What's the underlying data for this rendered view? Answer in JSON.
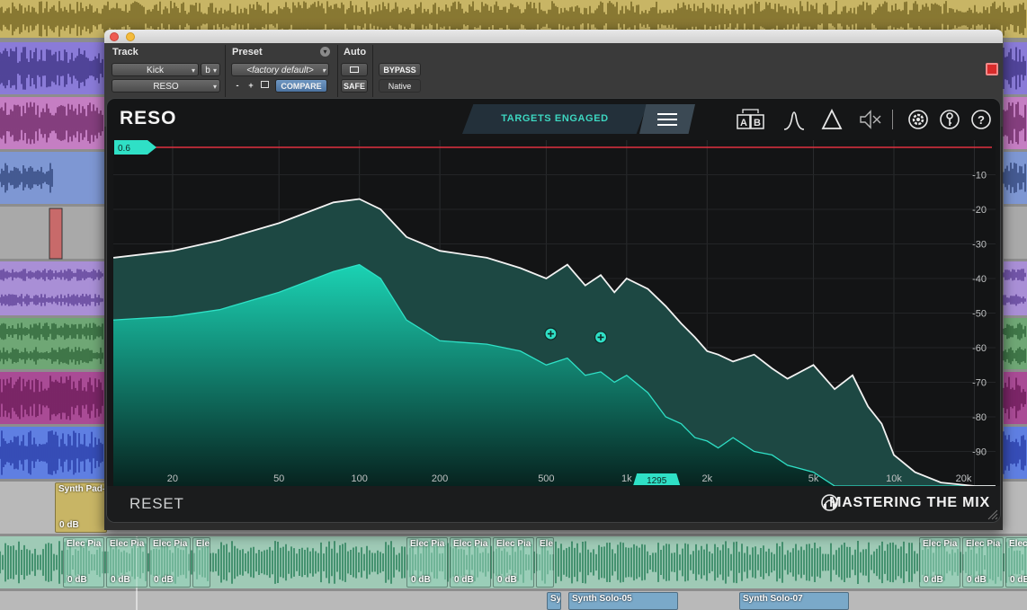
{
  "daw": {
    "top_clips": [
      {
        "name": "Synth Pad-",
        "gain": "0 dB"
      }
    ],
    "elec_clips": [
      {
        "name": "Elec Pia",
        "gain": "0 dB"
      },
      {
        "name": "Elec Pia",
        "gain": "0 dB"
      },
      {
        "name": "Elec Pia",
        "gain": "0 dB"
      },
      {
        "name": "Ele",
        "gain": ""
      },
      {
        "name": "Elec Pia",
        "gain": "0 dB"
      },
      {
        "name": "Elec Pia",
        "gain": "0 dB"
      },
      {
        "name": "Elec Pia",
        "gain": "0 dB"
      },
      {
        "name": "Ele",
        "gain": ""
      },
      {
        "name": "Elec Pia",
        "gain": "0 dB"
      },
      {
        "name": "Elec Pia",
        "gain": "0 dB"
      },
      {
        "name": "Elec Pia",
        "gain": "0 dB"
      }
    ],
    "solo_clips": [
      {
        "name": "Sy"
      },
      {
        "name": "Synth Solo-05"
      },
      {
        "name": "Synth Solo-07"
      }
    ]
  },
  "plugin_header": {
    "track_label": "Track",
    "preset_label": "Preset",
    "auto_label": "Auto",
    "track_name": "Kick",
    "track_side": "b",
    "insert_name": "RESO",
    "preset_value": "<factory default>",
    "minus": "-",
    "plus": "+",
    "compare": "COMPARE",
    "safe": "SAFE",
    "bypass": "BYPASS",
    "native": "Native"
  },
  "plugin": {
    "logo": "RESO",
    "targets_label": "TARGETS ENGAGED",
    "threshold_value": "0.6",
    "freq_handle": "1295",
    "reset_label": "RESET",
    "brand": "MASTERING THE MIX",
    "icons": [
      "ab-compare-icon",
      "filter-shape-icon",
      "triangle-icon",
      "mute-speaker-icon",
      "settings-gear-icon",
      "key-icon",
      "help-icon"
    ],
    "accent_color": "#2fe0c6",
    "threshold_color": "#e03040"
  },
  "chart_data": {
    "type": "area",
    "x_scale": "log",
    "x_ticks": [
      20,
      50,
      100,
      200,
      500,
      1000,
      2000,
      5000,
      10000,
      20000
    ],
    "x_tick_labels": [
      "20",
      "50",
      "100",
      "200",
      "500",
      "1k",
      "2k",
      "5k",
      "10k",
      "20k"
    ],
    "y_ticks": [
      -10,
      -20,
      -30,
      -40,
      -50,
      -60,
      -70,
      -80,
      -90
    ],
    "y_tick_labels": [
      "-10",
      "-20",
      "-30",
      "-40",
      "-50",
      "-60",
      "-70",
      "-80",
      "-90"
    ],
    "xlim": [
      12,
      24000
    ],
    "ylim": [
      -100,
      0
    ],
    "series": [
      {
        "x": [
          12,
          20,
          30,
          50,
          80,
          100,
          120,
          150,
          200,
          300,
          400,
          500,
          600,
          700,
          800,
          900,
          1000,
          1200,
          1400,
          1600,
          1800,
          2000,
          2200,
          2500,
          3000,
          3500,
          4000,
          5000,
          6000,
          7000,
          8000,
          9000,
          10000,
          12000,
          15000,
          20000,
          24000
        ],
        "y": [
          -34,
          -32,
          -29,
          -24,
          -18,
          -17,
          -20,
          -28,
          -32,
          -34,
          -37,
          -40,
          -36,
          -42,
          -39,
          -44,
          -40,
          -43,
          -48,
          -53,
          -57,
          -61,
          -62,
          -64,
          -62,
          -66,
          -69,
          -65,
          -72,
          -68,
          -77,
          -82,
          -91,
          -96,
          -99,
          -100,
          -100
        ]
      },
      {
        "x": [
          12,
          20,
          30,
          50,
          80,
          100,
          120,
          150,
          200,
          300,
          400,
          500,
          600,
          700,
          800,
          900,
          1000,
          1200,
          1400,
          1600,
          1800,
          2000,
          2200,
          2500,
          3000,
          3500,
          4000,
          5000,
          6000,
          7000,
          8000,
          9000,
          10000,
          12000,
          15000,
          20000,
          24000
        ],
        "y": [
          -52,
          -51,
          -49,
          -44,
          -38,
          -36,
          -40,
          -52,
          -58,
          -59,
          -61,
          -65,
          -63,
          -68,
          -67,
          -70,
          -68,
          -73,
          -80,
          -82,
          -86,
          -87,
          -89,
          -86,
          -90,
          -91,
          -94,
          -96,
          -100,
          -100,
          -100,
          -100,
          -100,
          -100,
          -100,
          -100,
          -100
        ]
      }
    ],
    "threshold": 0.6,
    "markers": [
      {
        "x": 520,
        "y": -56
      },
      {
        "x": 800,
        "y": -57
      }
    ]
  }
}
